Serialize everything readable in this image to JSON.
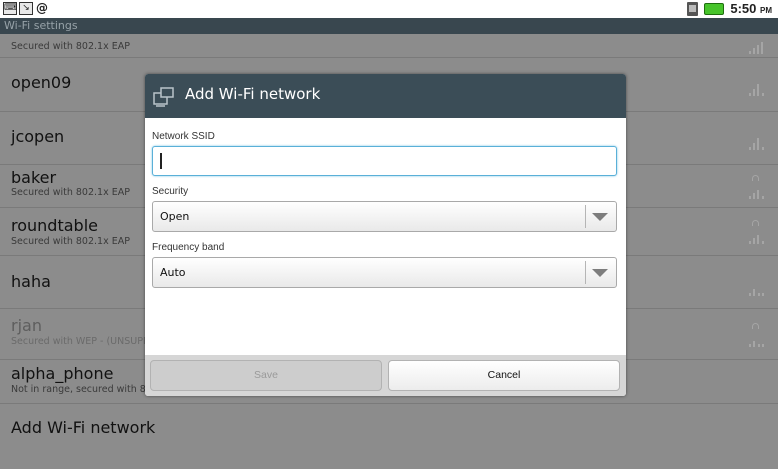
{
  "status_bar": {
    "time": "5:50",
    "ampm": "PM"
  },
  "app_title": "Wi-Fi settings",
  "networks": [
    {
      "name": "",
      "subtitle": "Secured with 802.1x EAP",
      "locked": true
    },
    {
      "name": "open09",
      "subtitle": "",
      "locked": false
    },
    {
      "name": "jcopen",
      "subtitle": "",
      "locked": false
    },
    {
      "name": "baker",
      "subtitle": "Secured with 802.1x EAP",
      "locked": true
    },
    {
      "name": "roundtable",
      "subtitle": "Secured with 802.1x EAP",
      "locked": true
    },
    {
      "name": "haha",
      "subtitle": "",
      "locked": false
    },
    {
      "name": "rjan",
      "subtitle": "Secured with WEP - (UNSUPPO",
      "locked": true
    },
    {
      "name": "alpha_phone",
      "subtitle": "Not in range, secured with 80",
      "locked": false
    },
    {
      "name": "Add Wi-Fi network",
      "subtitle": "",
      "locked": false
    }
  ],
  "dialog": {
    "title": "Add Wi-Fi network",
    "ssid_label": "Network SSID",
    "ssid_value": "",
    "security_label": "Security",
    "security_value": "Open",
    "band_label": "Frequency band",
    "band_value": "Auto",
    "save_label": "Save",
    "cancel_label": "Cancel"
  }
}
